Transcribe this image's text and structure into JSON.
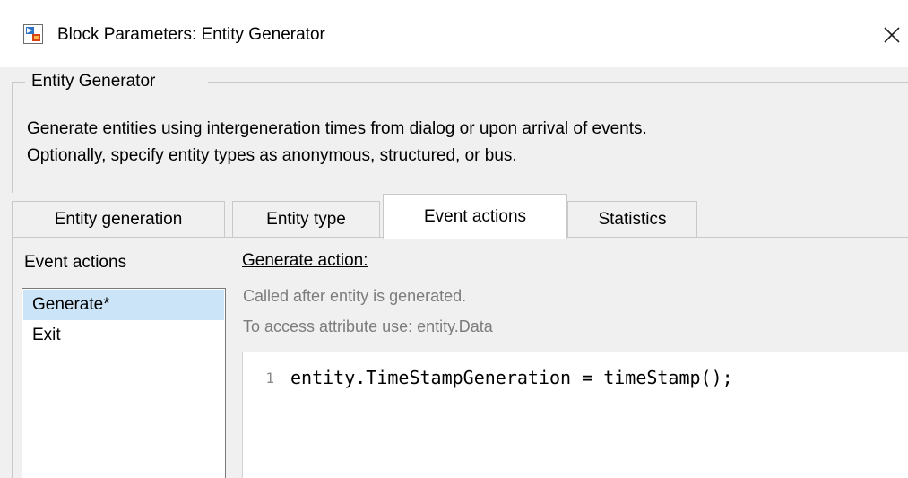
{
  "window": {
    "title": "Block Parameters: Entity Generator",
    "icon": "simulink-block-icon",
    "close_icon": "close-icon"
  },
  "block": {
    "group_title": "Entity Generator",
    "description_line1": "Generate entities using intergeneration times from dialog or upon arrival of events.",
    "description_line2": "Optionally, specify entity types as anonymous, structured, or bus."
  },
  "tabs": [
    {
      "label": "Entity generation",
      "active": false
    },
    {
      "label": "Entity type",
      "active": false
    },
    {
      "label": "Event actions",
      "active": true
    },
    {
      "label": "Statistics",
      "active": false
    }
  ],
  "event_actions": {
    "list_label": "Event actions",
    "items": [
      {
        "label": "Generate*",
        "selected": true
      },
      {
        "label": "Exit",
        "selected": false
      }
    ],
    "action_title": "Generate action:",
    "hint_line1": "Called after entity is generated.",
    "hint_line2": "To access attribute use: entity.Data",
    "code": {
      "line_number": "1",
      "line": "entity.TimeStampGeneration = timeStamp();"
    }
  },
  "colors": {
    "selection": "#cce4f7",
    "panel_bg": "#f0f0f0",
    "hint_text": "#7c7c7c"
  }
}
